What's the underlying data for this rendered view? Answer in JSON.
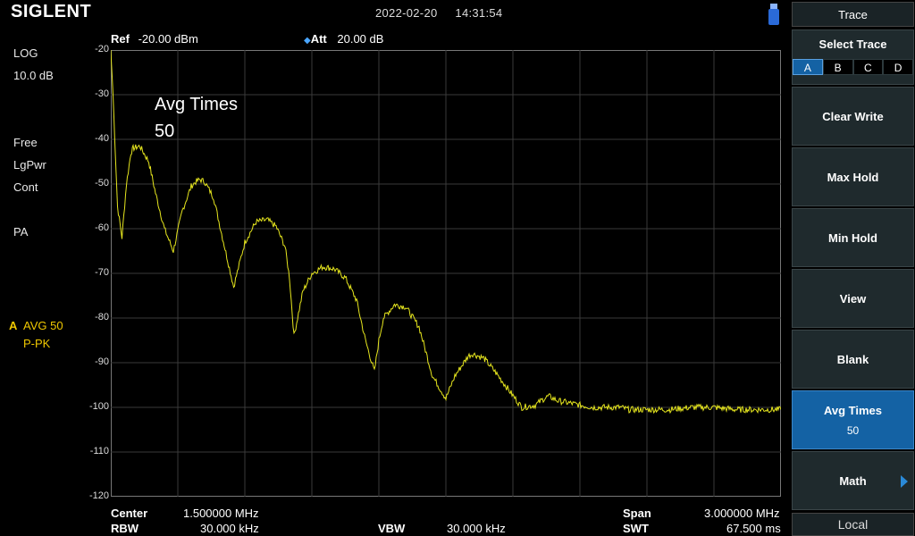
{
  "header": {
    "logo": "SIGLENT",
    "date": "2022-02-20",
    "time": "14:31:54"
  },
  "left_status": {
    "scale_type": "LOG",
    "scale_div": "10.0 dB",
    "trigger": "Free",
    "detector": "LgPwr",
    "sweep": "Cont",
    "preamp": "PA",
    "trace_letter": "A",
    "trace_mode": "AVG 50",
    "trace_detector": "P-PK"
  },
  "top_params": {
    "ref_label": "Ref",
    "ref_value": "-20.00 dBm",
    "att_marker": "◆",
    "att_label": "Att",
    "att_value": "20.00 dB"
  },
  "overlay": {
    "avg_label": "Avg Times",
    "avg_value": "50"
  },
  "bottom_params": {
    "center_label": "Center",
    "center_value": "1.500000 MHz",
    "rbw_label": "RBW",
    "rbw_value": "30.000 kHz",
    "vbw_label": "VBW",
    "vbw_value": "30.000 kHz",
    "span_label": "Span",
    "span_value": "3.000000 MHz",
    "swt_label": "SWT",
    "swt_value": "67.500 ms"
  },
  "softkeys": {
    "menu_title": "Trace",
    "select_trace_label": "Select Trace",
    "traces": [
      "A",
      "B",
      "C",
      "D"
    ],
    "selected_trace": "A",
    "clear_write": "Clear Write",
    "max_hold": "Max Hold",
    "min_hold": "Min Hold",
    "view": "View",
    "blank": "Blank",
    "avg_times_label": "Avg Times",
    "avg_times_value": "50",
    "math": "Math",
    "local": "Local"
  },
  "colors": {
    "trace": "#e6e61e",
    "grid": "#3a3a3a",
    "active_key": "#1462a4"
  },
  "chart_data": {
    "type": "line",
    "xlabel": "",
    "ylabel": "",
    "ylim": [
      -120,
      -20
    ],
    "xlim": [
      0,
      3.0
    ],
    "y_ticks": [
      "-20",
      "-30",
      "-40",
      "-50",
      "-60",
      "-70",
      "-80",
      "-90",
      "-100",
      "-110",
      "-120"
    ],
    "grid": true,
    "series": [
      {
        "x": [
          0.0,
          0.01,
          0.03,
          0.05,
          0.07,
          0.09,
          0.1,
          0.13,
          0.17,
          0.2,
          0.24,
          0.28,
          0.32,
          0.36,
          0.38,
          0.4,
          0.42,
          0.46,
          0.5,
          0.55,
          0.6,
          0.65,
          0.7,
          0.74,
          0.78,
          0.8,
          0.82,
          0.86,
          0.9,
          0.95,
          1.0,
          1.05,
          1.1,
          1.14,
          1.18,
          1.2,
          1.22,
          1.27,
          1.32,
          1.38,
          1.44,
          1.5,
          1.54,
          1.58,
          1.6,
          1.62,
          1.67,
          1.72,
          1.78,
          1.84,
          1.9,
          1.94,
          1.96,
          1.98,
          2.0,
          2.05,
          2.1,
          2.16,
          2.22,
          2.28,
          2.32,
          2.34,
          2.36,
          2.4,
          2.45,
          2.5,
          2.6,
          2.7,
          2.8,
          2.9,
          3.0
        ],
        "y": [
          -20,
          -30,
          -55,
          -62,
          -50,
          -43,
          -42,
          -41.5,
          -45,
          -52,
          -60,
          -65,
          -56,
          -50.5,
          -49.5,
          -49,
          -49.5,
          -53,
          -62,
          -73,
          -63,
          -58.5,
          -58,
          -59.5,
          -64,
          -71,
          -84,
          -74,
          -70,
          -68.5,
          -69,
          -71,
          -76,
          -85,
          -92,
          -85,
          -80,
          -77,
          -77.5,
          -82,
          -93,
          -98,
          -93,
          -90,
          -88.5,
          -88,
          -89,
          -92,
          -96,
          -100,
          -99.5,
          -98,
          -97.5,
          -98,
          -98.5,
          -99,
          -99.5,
          -100,
          -100,
          -100,
          -100.5,
          -100.5,
          -100.5,
          -100.5,
          -100.5,
          -100.5,
          -100,
          -100,
          -100.5,
          -100.5,
          -100.5
        ]
      }
    ]
  }
}
